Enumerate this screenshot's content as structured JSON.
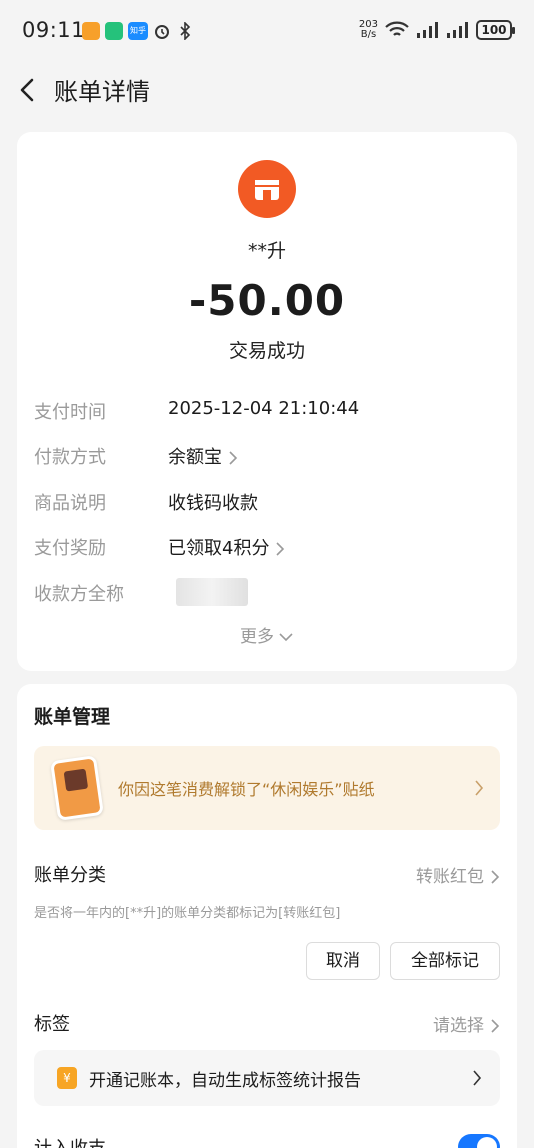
{
  "status_bar": {
    "time": "09:11",
    "net_speed_value": "203",
    "net_speed_unit": "B/s",
    "battery": "100",
    "apps": [
      "app-icon-orange",
      "app-icon-green",
      "zhihu-icon"
    ],
    "app_c_label": "知乎"
  },
  "nav": {
    "title": "账单详情"
  },
  "transaction": {
    "merchant_name": "**升",
    "amount": "-50.00",
    "status": "交易成功",
    "merchant_icon": "store-icon",
    "merchant_icon_color": "#f25a24"
  },
  "details": [
    {
      "label": "支付时间",
      "value": "2025-12-04 21:10:44"
    },
    {
      "label": "付款方式",
      "value": "余额宝"
    },
    {
      "label": "商品说明",
      "value": "收钱码收款"
    },
    {
      "label": "支付奖励",
      "value": "已领取4积分"
    },
    {
      "label": "收款方全称",
      "value": ""
    }
  ],
  "more_label": "更多",
  "management": {
    "title": "账单管理",
    "sticker_text": "你因这笔消费解锁了“休闲娱乐”贴纸",
    "category_label": "账单分类",
    "category_value": "转账红包",
    "category_hint": "是否将一年内的[**升]的账单分类都标记为[转账红包]",
    "cancel_label": "取消",
    "mark_all_label": "全部标记",
    "tag_label": "标签",
    "tag_placeholder": "请选择",
    "promo_icon": "¥",
    "promo_text": "开通记账本，自动生成标签统计报告",
    "income_label": "计入收支",
    "income_enabled": true
  },
  "colors": {
    "accent": "#1677ff",
    "merchant": "#f25a24",
    "sticker_text": "#b07a2e",
    "sticker_bg": "#fbf3e6"
  }
}
